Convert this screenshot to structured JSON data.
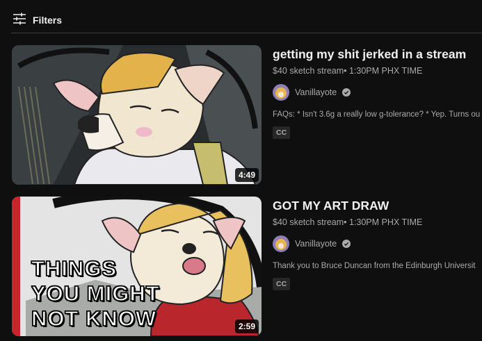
{
  "header": {
    "filters_label": "Filters",
    "filters_icon": "sliders-icon"
  },
  "videos": [
    {
      "title": "getting my shit jerked in a stream",
      "meta": "$40 sketch stream• 1:30PM PHX TIME",
      "channel": "Vanillayote",
      "description": "FAQs: * Isn't 3.6g a really low g-tolerance? * Yep. Turns ou",
      "badge": "CC",
      "duration": "4:49"
    },
    {
      "title": "GOT MY ART DRAW",
      "meta": "$40 sketch stream• 1:30PM PHX TIME",
      "channel": "Vanillayote",
      "description": "Thank you to Bruce Duncan from the Edinburgh Universit",
      "badge": "CC",
      "duration": "2:59",
      "overlay_lines": [
        "THINGS",
        "YOU MIGHT",
        "NOT KNOW"
      ]
    }
  ],
  "colors": {
    "background": "#0f0f0f",
    "text_primary": "#f1f1f1",
    "text_secondary": "#aaaaaa",
    "badge_bg": "#272727"
  }
}
